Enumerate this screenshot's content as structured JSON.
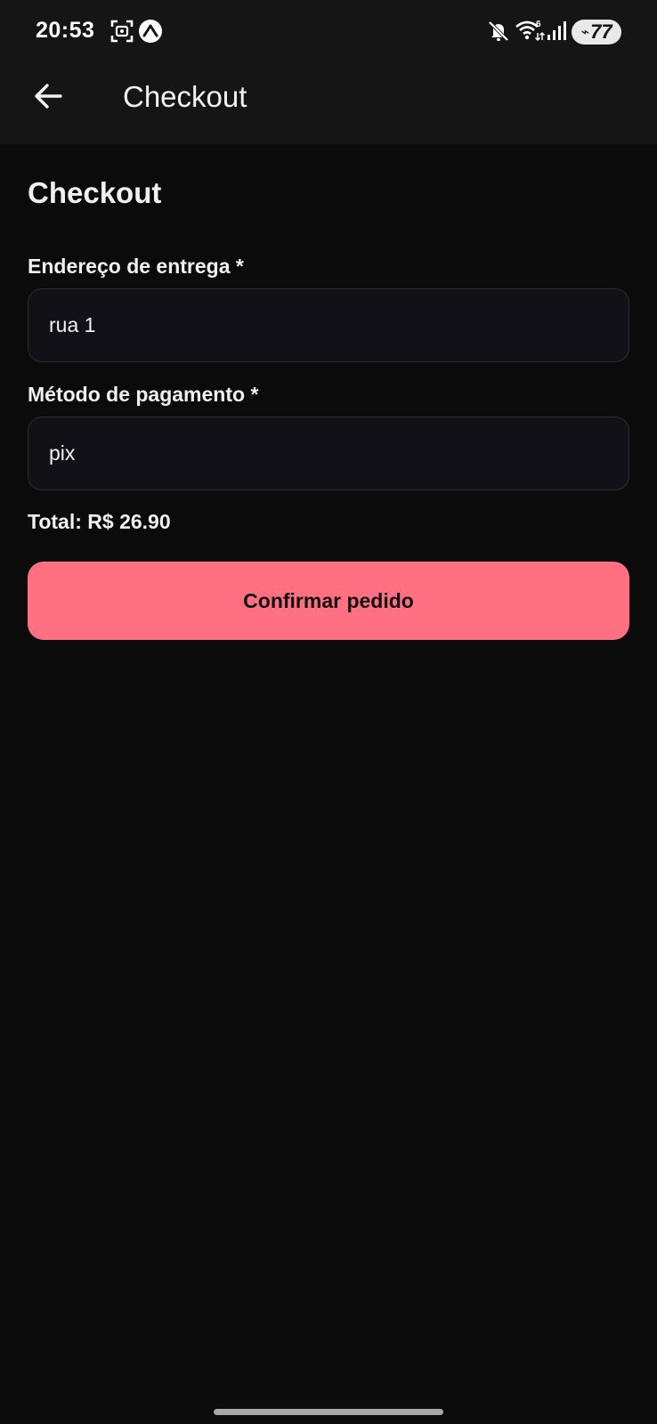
{
  "status_bar": {
    "time": "20:53",
    "battery_level": "77",
    "icons": [
      "screenshot-icon",
      "expo-icon",
      "mute-icon",
      "wifi-icon",
      "signal-icon",
      "battery-icon"
    ]
  },
  "app_bar": {
    "title": "Checkout",
    "back_icon": "arrow-left-icon"
  },
  "form": {
    "heading": "Checkout",
    "address_label": "Endereço de entrega *",
    "address_value": "rua 1",
    "payment_label": "Método de pagamento *",
    "payment_value": "pix",
    "total": "Total: R$ 26.90",
    "confirm_label": "Confirmar pedido"
  },
  "colors": {
    "background": "#0b0b0c",
    "bar_background": "#151515",
    "input_background": "#121216",
    "input_border": "#2c2c33",
    "accent": "#ff7083"
  }
}
